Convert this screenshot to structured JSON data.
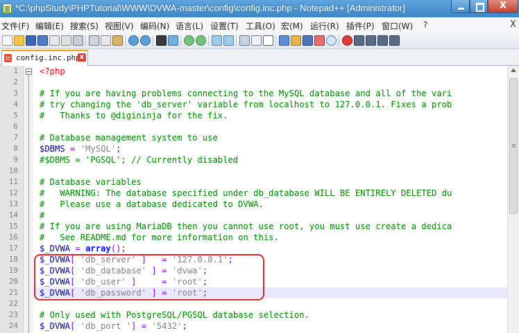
{
  "window": {
    "title": "*C:\\phpStudy\\PHPTutorial\\WWW\\DVWA-master\\config\\config.inc.php - Notepad++ [Administrator]",
    "minimize_glyph": "",
    "maximize_glyph": "",
    "close_glyph": "X"
  },
  "menu": {
    "items": [
      "文件(F)",
      "编辑(E)",
      "搜索(S)",
      "视图(V)",
      "编码(N)",
      "语言(L)",
      "设置(T)",
      "工具(O)",
      "宏(M)",
      "运行(R)",
      "插件(P)",
      "窗口(W)",
      "?"
    ],
    "close_doc": "X"
  },
  "toolbar": {
    "icons": [
      "new-file-icon",
      "open-file-icon",
      "save-icon",
      "save-all-icon",
      "close-icon",
      "close-all-icon",
      "print-icon",
      "cut-icon",
      "copy-icon",
      "paste-icon",
      "undo-icon",
      "redo-icon",
      "find-icon",
      "replace-icon",
      "zoom-in-icon",
      "zoom-out-icon",
      "sync-vertical-icon",
      "sync-horizontal-icon",
      "word-wrap-icon",
      "show-all-chars-icon",
      "indent-guide-icon",
      "doc-map-icon",
      "function-list-icon",
      "folder-workspace-icon",
      "monitor-icon",
      "record-macro-icon",
      "stop-record-icon",
      "play-macro-icon",
      "run-macro-icon",
      "save-macro-icon"
    ]
  },
  "tabs": [
    {
      "label": "config.inc.php",
      "close": "x",
      "accent": "#f6a31b"
    }
  ],
  "editor": {
    "current_line": 21,
    "highlight_color": "#d9262c",
    "lines": [
      {
        "n": 1,
        "tokens": [
          {
            "c": "c-tag",
            "t": "<?php"
          }
        ]
      },
      {
        "n": 2,
        "tokens": []
      },
      {
        "n": 3,
        "tokens": [
          {
            "c": "c-comment",
            "t": "# If you are having problems connecting to the MySQL database and all of the vari"
          }
        ]
      },
      {
        "n": 4,
        "tokens": [
          {
            "c": "c-comment",
            "t": "# try changing the 'db_server' variable from localhost to 127.0.0.1. Fixes a prob"
          }
        ]
      },
      {
        "n": 5,
        "tokens": [
          {
            "c": "c-comment",
            "t": "#   Thanks to @digininja for the fix."
          }
        ]
      },
      {
        "n": 6,
        "tokens": []
      },
      {
        "n": 7,
        "tokens": [
          {
            "c": "c-comment",
            "t": "# Database management system to use"
          }
        ]
      },
      {
        "n": 8,
        "tokens": [
          {
            "c": "c-var",
            "t": "$DBMS"
          },
          {
            "c": "c-plain",
            "t": " "
          },
          {
            "c": "c-op",
            "t": "="
          },
          {
            "c": "c-plain",
            "t": " "
          },
          {
            "c": "c-str",
            "t": "'MySQL'"
          },
          {
            "c": "c-op",
            "t": ";"
          }
        ]
      },
      {
        "n": 9,
        "tokens": [
          {
            "c": "c-comment",
            "t": "#$DBMS = 'PGSQL'; // Currently disabled"
          }
        ]
      },
      {
        "n": 10,
        "tokens": []
      },
      {
        "n": 11,
        "tokens": [
          {
            "c": "c-comment",
            "t": "# Database variables"
          }
        ]
      },
      {
        "n": 12,
        "tokens": [
          {
            "c": "c-comment",
            "t": "#   WARNING: The database specified under db_database WILL BE ENTIRELY DELETED du"
          }
        ]
      },
      {
        "n": 13,
        "tokens": [
          {
            "c": "c-comment",
            "t": "#   Please use a database dedicated to DVWA."
          }
        ]
      },
      {
        "n": 14,
        "tokens": [
          {
            "c": "c-comment",
            "t": "#"
          }
        ]
      },
      {
        "n": 15,
        "tokens": [
          {
            "c": "c-comment",
            "t": "# If you are using MariaDB then you cannot use root, you must use create a dedica"
          }
        ]
      },
      {
        "n": 16,
        "tokens": [
          {
            "c": "c-comment",
            "t": "#   See README.md for more information on this."
          }
        ]
      },
      {
        "n": 17,
        "tokens": [
          {
            "c": "c-var",
            "t": "$_DVWA"
          },
          {
            "c": "c-plain",
            "t": " "
          },
          {
            "c": "c-op",
            "t": "="
          },
          {
            "c": "c-plain",
            "t": " "
          },
          {
            "c": "c-kw",
            "t": "array"
          },
          {
            "c": "c-op",
            "t": "();"
          }
        ]
      },
      {
        "n": 18,
        "tokens": [
          {
            "c": "c-var",
            "t": "$_DVWA"
          },
          {
            "c": "c-op",
            "t": "["
          },
          {
            "c": "c-plain",
            "t": " "
          },
          {
            "c": "c-str",
            "t": "'db_server'"
          },
          {
            "c": "c-plain",
            "t": " "
          },
          {
            "c": "c-op",
            "t": "]"
          },
          {
            "c": "c-plain",
            "t": "   "
          },
          {
            "c": "c-op",
            "t": "="
          },
          {
            "c": "c-plain",
            "t": " "
          },
          {
            "c": "c-str",
            "t": "'127.0.0.1'"
          },
          {
            "c": "c-op",
            "t": ";"
          }
        ]
      },
      {
        "n": 19,
        "tokens": [
          {
            "c": "c-var",
            "t": "$_DVWA"
          },
          {
            "c": "c-op",
            "t": "["
          },
          {
            "c": "c-plain",
            "t": " "
          },
          {
            "c": "c-str",
            "t": "'db_database'"
          },
          {
            "c": "c-plain",
            "t": " "
          },
          {
            "c": "c-op",
            "t": "]"
          },
          {
            "c": "c-plain",
            "t": " "
          },
          {
            "c": "c-op",
            "t": "="
          },
          {
            "c": "c-plain",
            "t": " "
          },
          {
            "c": "c-str",
            "t": "'dvwa'"
          },
          {
            "c": "c-op",
            "t": ";"
          }
        ]
      },
      {
        "n": 20,
        "tokens": [
          {
            "c": "c-var",
            "t": "$_DVWA"
          },
          {
            "c": "c-op",
            "t": "["
          },
          {
            "c": "c-plain",
            "t": " "
          },
          {
            "c": "c-str",
            "t": "'db_user'"
          },
          {
            "c": "c-plain",
            "t": " "
          },
          {
            "c": "c-op",
            "t": "]"
          },
          {
            "c": "c-plain",
            "t": "     "
          },
          {
            "c": "c-op",
            "t": "="
          },
          {
            "c": "c-plain",
            "t": " "
          },
          {
            "c": "c-str",
            "t": "'root'"
          },
          {
            "c": "c-op",
            "t": ";"
          }
        ]
      },
      {
        "n": 21,
        "tokens": [
          {
            "c": "c-var",
            "t": "$_DVWA"
          },
          {
            "c": "c-op",
            "t": "["
          },
          {
            "c": "c-plain",
            "t": " "
          },
          {
            "c": "c-str",
            "t": "'db_password'"
          },
          {
            "c": "c-plain",
            "t": " "
          },
          {
            "c": "c-op",
            "t": "]"
          },
          {
            "c": "c-plain",
            "t": " "
          },
          {
            "c": "c-op",
            "t": "="
          },
          {
            "c": "c-plain",
            "t": " "
          },
          {
            "c": "c-str",
            "t": "'root'"
          },
          {
            "c": "c-op",
            "t": ";"
          }
        ]
      },
      {
        "n": 22,
        "tokens": []
      },
      {
        "n": 23,
        "tokens": [
          {
            "c": "c-comment",
            "t": "# Only used with PostgreSQL/PGSQL database selection."
          }
        ]
      },
      {
        "n": 24,
        "tokens": [
          {
            "c": "c-var",
            "t": "$_DVWA"
          },
          {
            "c": "c-op",
            "t": "["
          },
          {
            "c": "c-plain",
            "t": " "
          },
          {
            "c": "c-str",
            "t": "'db_port '"
          },
          {
            "c": "c-op",
            "t": "]"
          },
          {
            "c": "c-plain",
            "t": " "
          },
          {
            "c": "c-op",
            "t": "="
          },
          {
            "c": "c-plain",
            "t": " "
          },
          {
            "c": "c-str",
            "t": "'5432'"
          },
          {
            "c": "c-op",
            "t": ";"
          }
        ]
      }
    ]
  }
}
